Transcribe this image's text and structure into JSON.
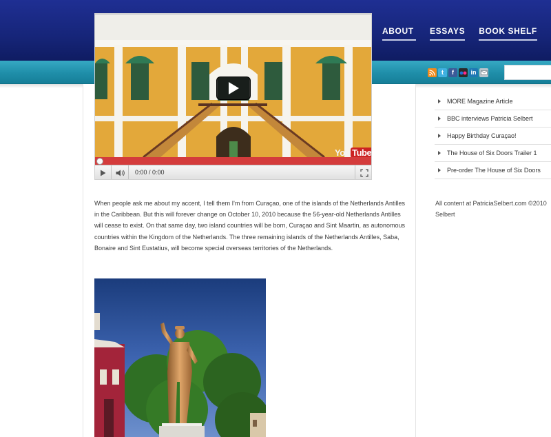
{
  "nav": {
    "items": [
      "ABOUT",
      "ESSAYS",
      "BOOK SHELF"
    ]
  },
  "social": {
    "icons": [
      "rss-icon",
      "twitter-icon",
      "facebook-icon",
      "flickr-icon",
      "linkedin-icon",
      "mail-icon"
    ]
  },
  "search": {
    "placeholder": ""
  },
  "video": {
    "time": "0:00 / 0:00",
    "logo_you": "You",
    "logo_tube": "Tube"
  },
  "article": {
    "paragraph": "When people ask me about my accent, I tell them I'm from Curaçao, one of the islands of the Netherlands Antilles in the Caribbean. But this will forever change on October 10, 2010 because the 56-year-old Netherlands Antilles will cease to exist. On that same day, two island countries will be born, Curaçao and Sint Maartin, as autonomous countries within the Kingdom of the Netherlands. The three remaining islands of the Netherlands Antilles, Saba, Bonaire and Sint Eustatius, will become special overseas territories of the Netherlands."
  },
  "sidebar": {
    "links": [
      "MORE Magazine Article",
      "BBC interviews Patricia Selbert",
      "Happy Birthday Curaçao!",
      "The House of Six Doors Trailer 1",
      "Pre-order The House of Six Doors"
    ],
    "copyright_line1": "All content at PatriciaSelbert.com ©2010",
    "copyright_line2": "Selbert"
  },
  "colors": {
    "header_navy": "#162579",
    "header_teal": "#1f8ea9",
    "video_progress": "#d43c3c"
  }
}
